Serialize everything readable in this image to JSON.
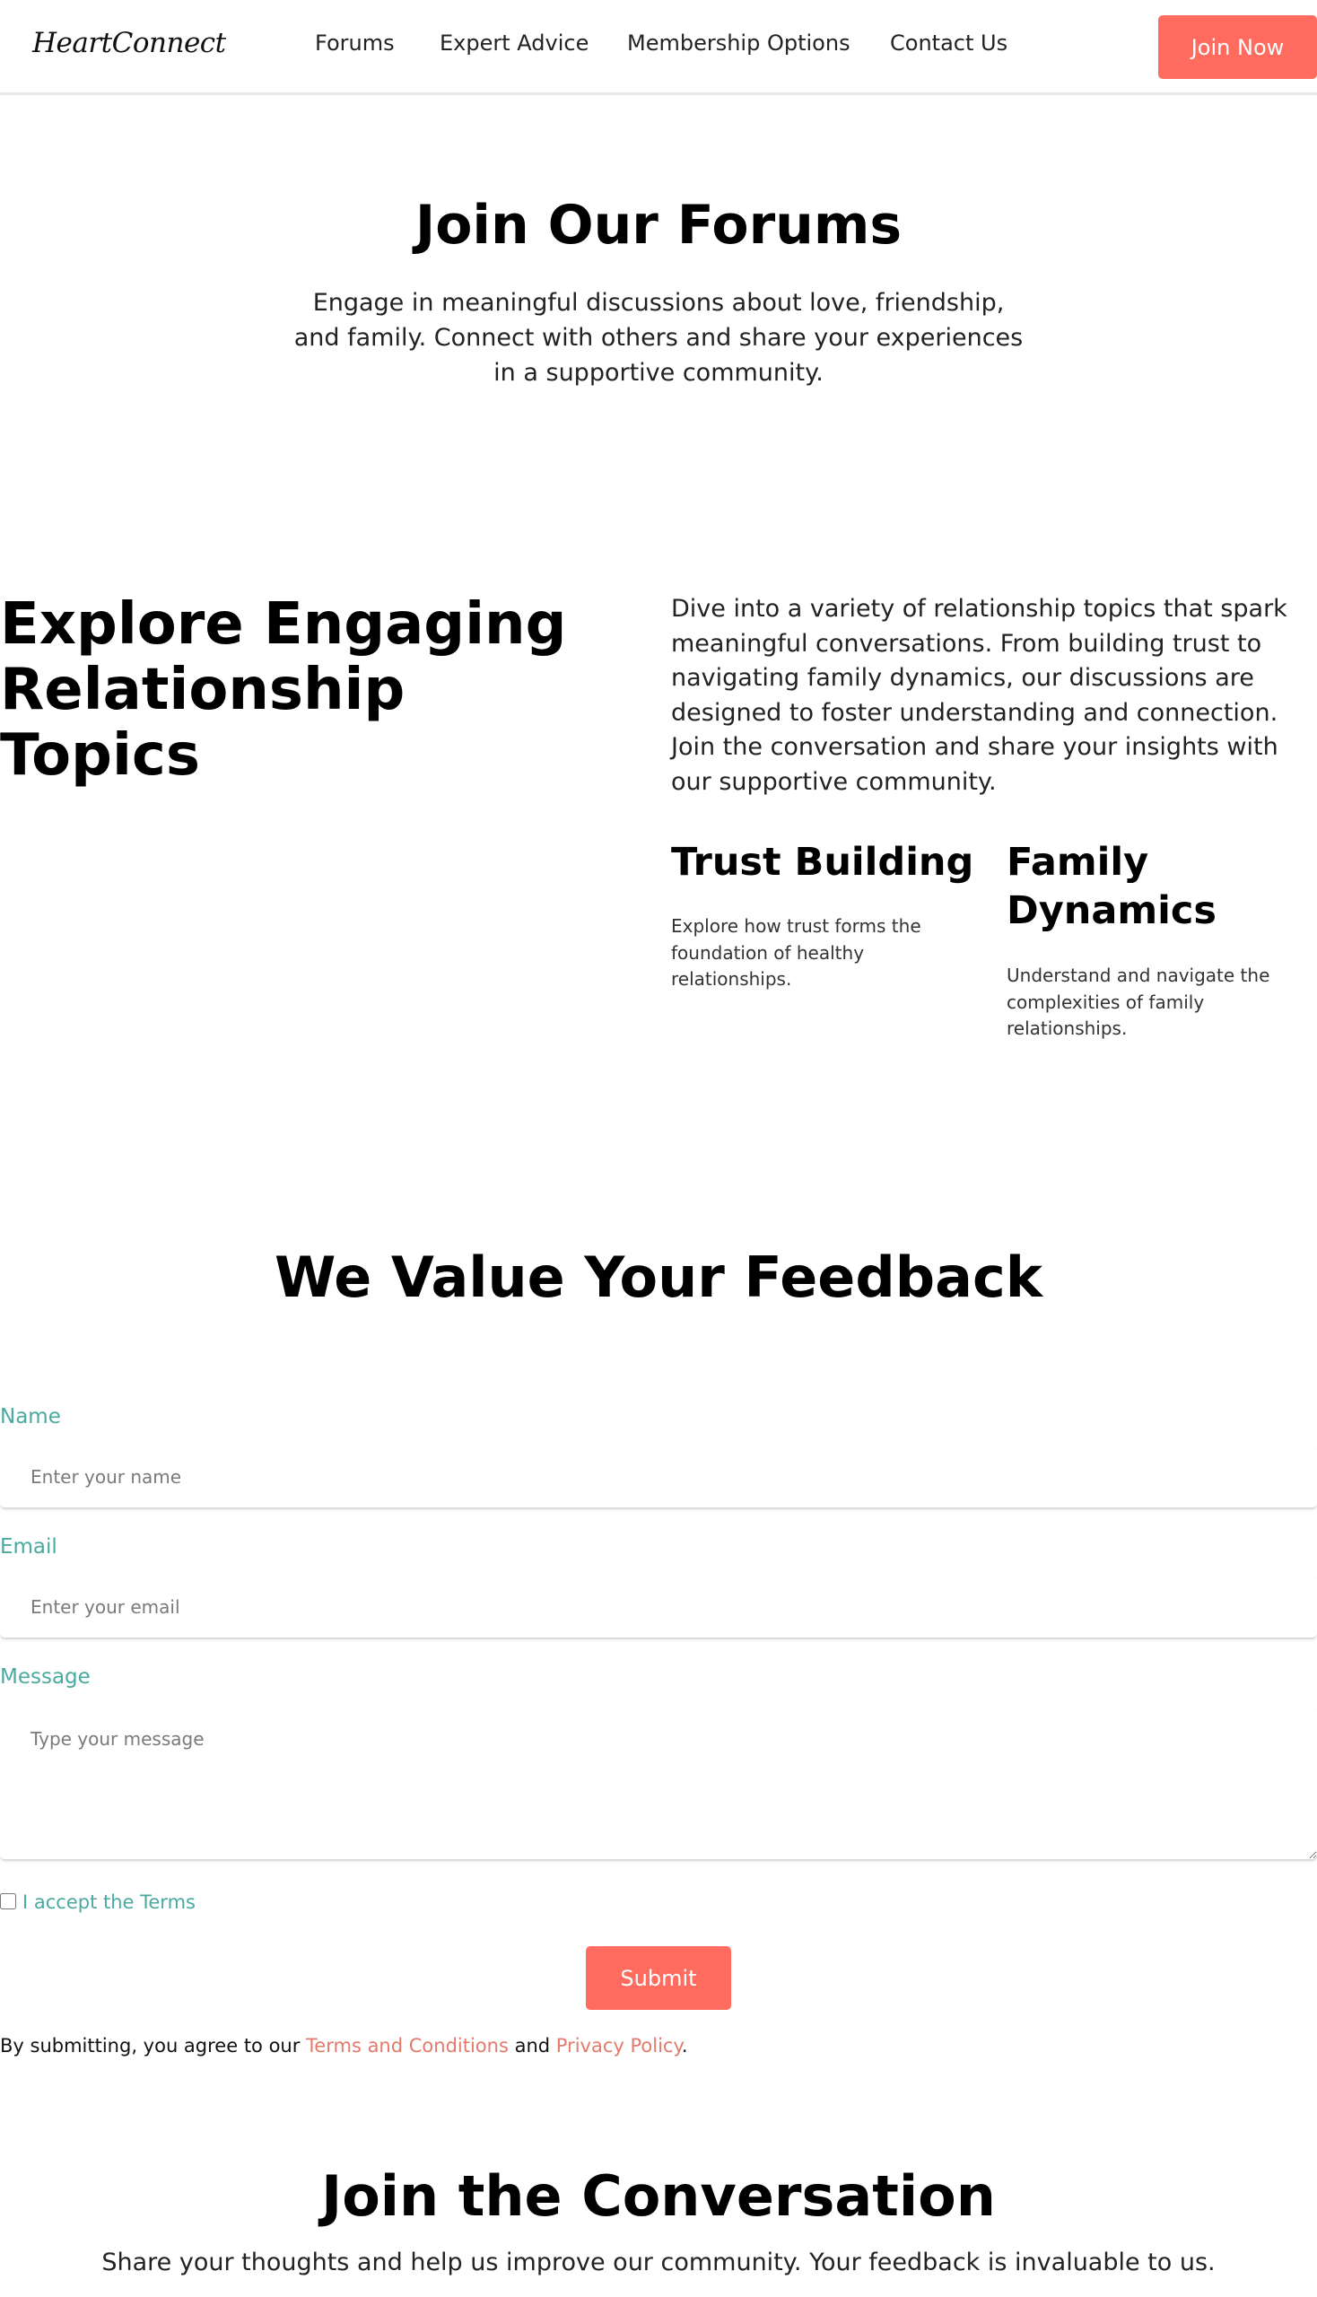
{
  "nav": {
    "logo": "HeartConnect",
    "links": [
      "Forums",
      "Expert Advice",
      "Membership Options",
      "Contact Us"
    ],
    "cta": "Join Now"
  },
  "hero": {
    "title": "Join Our Forums",
    "text": "Engage in meaningful discussions about love, friendship, and family. Connect with others and share your experiences in a supportive community."
  },
  "topics": {
    "title": "Explore Engaging Relationship Topics",
    "text": "Dive into a variety of relationship topics that spark meaningful conversations. From building trust to navigating family dynamics, our discussions are designed to foster understanding and connection. Join the conversation and share your insights with our supportive community.",
    "cards": [
      {
        "title": "Trust Building",
        "text": "Explore how trust forms the foundation of healthy relationships."
      },
      {
        "title": "Family Dynamics",
        "text": "Understand and navigate the complexities of family relationships."
      }
    ]
  },
  "feedback": {
    "title": "We Value Your Feedback",
    "name_label": "Name",
    "name_placeholder": "Enter your name",
    "email_label": "Email",
    "email_placeholder": "Enter your email",
    "message_label": "Message",
    "message_placeholder": "Type your message",
    "terms_label": "I accept the Terms",
    "submit": "Submit",
    "legal_prefix": "By submitting, you agree to our ",
    "terms_link": "Terms and Conditions",
    "legal_and": " and ",
    "privacy_link": "Privacy Policy",
    "legal_suffix": "."
  },
  "conversation": {
    "title": "Join the Conversation",
    "text": "Share your thoughts and help us improve our community. Your feedback is invaluable to us."
  },
  "colors": {
    "accent": "#ff6b5e",
    "label_teal": "#4aaaa0",
    "link_coral": "#e37a6b"
  }
}
